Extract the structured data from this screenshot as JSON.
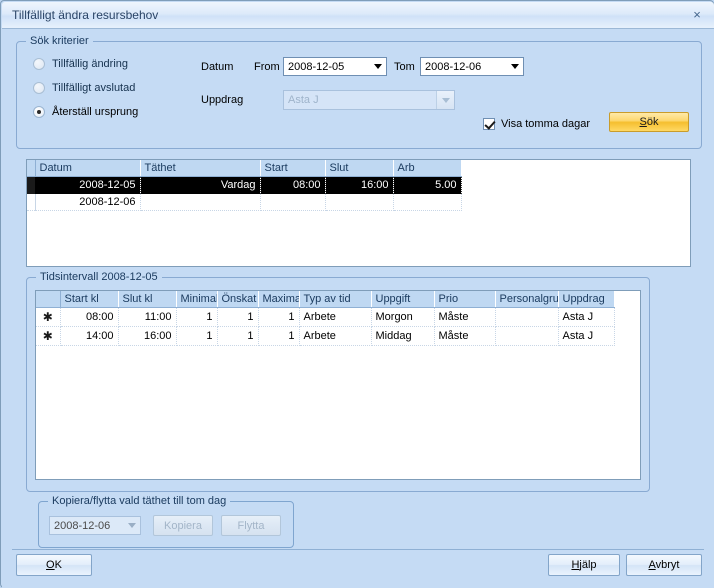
{
  "window": {
    "title": "Tillfälligt ändra resursbehov",
    "close_label": "×"
  },
  "search_criteria": {
    "legend": "Sök kriterier",
    "radios": [
      {
        "label": "Tillfällig ändring",
        "checked": false,
        "disabled": true
      },
      {
        "label": "Tillfälligt avslutad",
        "checked": false,
        "disabled": true
      },
      {
        "label": "Återställ ursprung",
        "checked": true,
        "disabled": false
      }
    ],
    "datum_label": "Datum",
    "from_label": "From",
    "from_value": "2008-12-05",
    "tom_label": "Tom",
    "tom_value": "2008-12-06",
    "uppdrag_label": "Uppdrag",
    "uppdrag_value": "Asta J",
    "visa_tomma_dagar_label": "Visa tomma dagar",
    "visa_tomma_dagar_checked": true,
    "sok_button": "Sök",
    "sok_accel": "S",
    "sok_rest": "ök"
  },
  "results_grid": {
    "columns": [
      "Datum",
      "Täthet",
      "Start",
      "Slut",
      "Arb"
    ],
    "rows": [
      {
        "selected": true,
        "cells": [
          "2008-12-05",
          "Vardag",
          "08:00",
          "16:00",
          "5.00"
        ]
      },
      {
        "selected": false,
        "cells": [
          "2008-12-06",
          "",
          "",
          "",
          ""
        ]
      }
    ]
  },
  "intervals": {
    "legend": "Tidsintervall 2008-12-05",
    "row_marker": "✱",
    "columns": [
      "Start kl",
      "Slut kl",
      "Minimal",
      "Önskat",
      "Maxima",
      "Typ av tid",
      "Uppgift",
      "Prio",
      "Personalgru",
      "Uppdrag"
    ],
    "rows": [
      {
        "marker": "✱",
        "cells": [
          "08:00",
          "11:00",
          "1",
          "1",
          "1",
          "Arbete",
          "Morgon",
          "Måste",
          "",
          "Asta J"
        ]
      },
      {
        "marker": "✱",
        "cells": [
          "14:00",
          "16:00",
          "1",
          "1",
          "1",
          "Arbete",
          "Middag",
          "Måste",
          "",
          "Asta J"
        ]
      }
    ]
  },
  "copy_move": {
    "legend": "Kopiera/flytta vald täthet till tom dag",
    "date_value": "2008-12-06",
    "kopiera_button": "Kopiera",
    "flytta_button": "Flytta"
  },
  "footer": {
    "ok_accel": "O",
    "ok_rest": "K",
    "hjalp_accel": "H",
    "hjalp_rest": "jälp",
    "avbryt_accel": "A",
    "avbryt_rest": "vbryt"
  }
}
